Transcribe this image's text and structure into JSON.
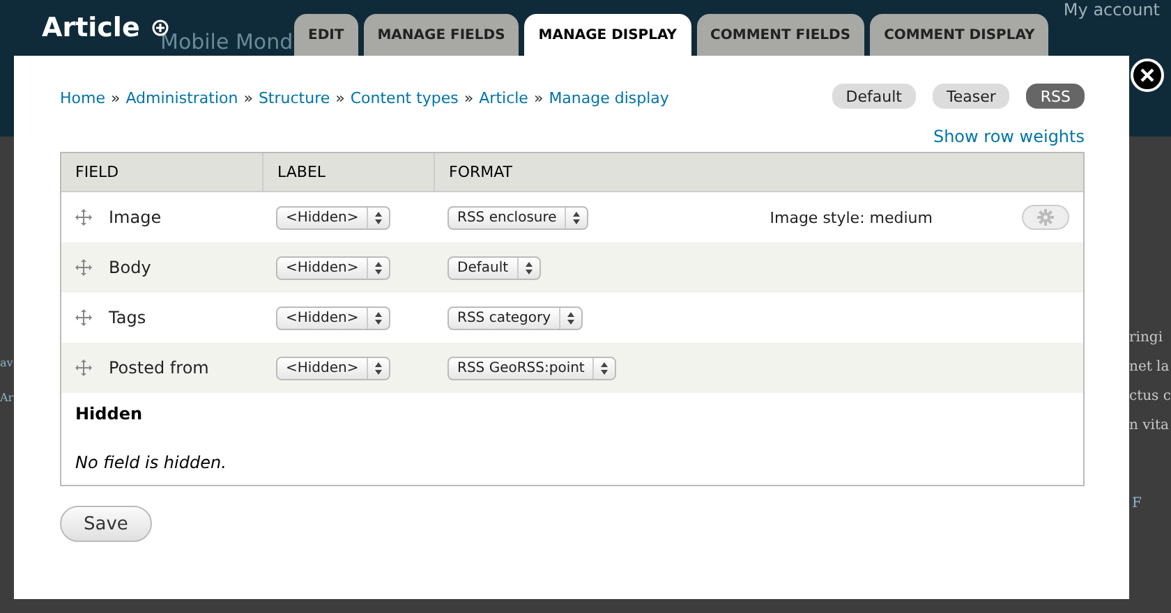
{
  "background": {
    "site_name": "Mobile Mond",
    "account_link": "My account",
    "left_text": [
      "av",
      "Ar"
    ],
    "right_text": [
      "ringi",
      "net la",
      "ctus c",
      "n vita"
    ],
    "right_link": "F"
  },
  "page_title": "Article",
  "tabs": [
    {
      "label": "EDIT",
      "selected": false
    },
    {
      "label": "MANAGE FIELDS",
      "selected": false
    },
    {
      "label": "MANAGE DISPLAY",
      "selected": true
    },
    {
      "label": "COMMENT FIELDS",
      "selected": false
    },
    {
      "label": "COMMENT DISPLAY",
      "selected": false
    }
  ],
  "breadcrumb": [
    {
      "kind": "link",
      "text": "Home"
    },
    {
      "kind": "separator",
      "text": "»"
    },
    {
      "kind": "link",
      "text": "Administration"
    },
    {
      "kind": "separator",
      "text": "»"
    },
    {
      "kind": "link",
      "text": "Structure"
    },
    {
      "kind": "separator",
      "text": "»"
    },
    {
      "kind": "link",
      "text": "Content types"
    },
    {
      "kind": "separator",
      "text": "»"
    },
    {
      "kind": "link",
      "text": "Article"
    },
    {
      "kind": "separator",
      "text": "»"
    },
    {
      "kind": "link",
      "text": "Manage display"
    }
  ],
  "view_modes": [
    {
      "label": "Default",
      "selected": false
    },
    {
      "label": "Teaser",
      "selected": false
    },
    {
      "label": "RSS",
      "selected": true
    }
  ],
  "row_weights_link": "Show row weights",
  "table": {
    "columns": [
      "FIELD",
      "LABEL",
      "FORMAT"
    ],
    "rows": [
      {
        "field": "Image",
        "label": "<Hidden>",
        "format": "RSS enclosure",
        "summary": "Image style: medium",
        "has_settings": true
      },
      {
        "field": "Body",
        "label": "<Hidden>",
        "format": "Default",
        "has_settings": false
      },
      {
        "field": "Tags",
        "label": "<Hidden>",
        "format": "RSS category",
        "has_settings": false
      },
      {
        "field": "Posted from",
        "label": "<Hidden>",
        "format": "RSS GeoRSS:point",
        "has_settings": false
      }
    ],
    "hidden_heading": "Hidden",
    "hidden_message": "No field is hidden."
  },
  "save_button": "Save"
}
